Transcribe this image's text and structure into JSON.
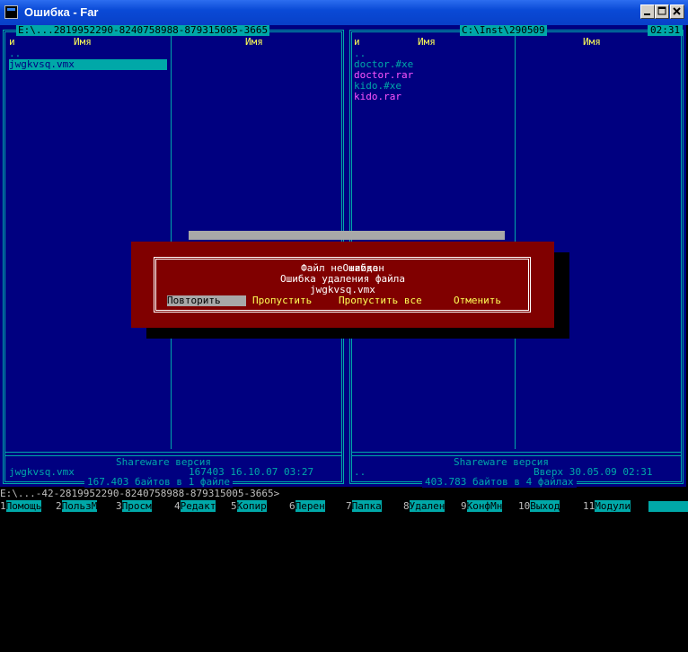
{
  "window": {
    "title": "Ошибка - Far"
  },
  "left_panel": {
    "path": "E:\\...2819952290-8240758988-879315005-3665",
    "col_headers": [
      "и",
      "Имя",
      "Имя"
    ],
    "items": [
      "..",
      "jwgkvsq.vmx"
    ],
    "shareware": "Shareware версия",
    "status_name": "jwgkvsq.vmx",
    "status_info": "167403 16.10.07 03:27",
    "summary": "167.403 байтов в 1 файле"
  },
  "right_panel": {
    "path": "C:\\Inst\\290509",
    "clock": "02:31",
    "col_headers": [
      "и",
      "Имя",
      "Имя"
    ],
    "items": [
      "..",
      "doctor.#xe",
      "doctor.rar",
      "kido.#xe",
      "kido.rar"
    ],
    "shareware": "Shareware версия",
    "status_name": "..",
    "status_info": "Вверх 30.05.09 02:31",
    "summary": "403.783 байтов в 4 файлах"
  },
  "dialog": {
    "title": "Ошибка",
    "line1": "Файл не найден",
    "line2": "Ошибка удаления файла",
    "line3": "jwgkvsq.vmx",
    "buttons": [
      "Повторить",
      "Пропустить",
      "Пропустить все",
      "Отменить"
    ]
  },
  "command_line": "E:\\...-42-2819952290-8240758988-879315005-3665>",
  "keybar": [
    {
      "num": "1",
      "label": "Помощь"
    },
    {
      "num": "2",
      "label": "ПользМ"
    },
    {
      "num": "3",
      "label": "Просм"
    },
    {
      "num": "4",
      "label": "Редакт"
    },
    {
      "num": "5",
      "label": "Копир"
    },
    {
      "num": "6",
      "label": "Перен"
    },
    {
      "num": "7",
      "label": "Папка"
    },
    {
      "num": "8",
      "label": "Удален"
    },
    {
      "num": "9",
      "label": "КонфМн"
    },
    {
      "num": "10",
      "label": "Выход"
    },
    {
      "num": "11",
      "label": "Модули"
    }
  ],
  "colors": {
    "panel_bg": "#000080",
    "frame": "#00a8a8",
    "header_text": "#ffff55",
    "archive_text": "#ff55ff",
    "dialog_bg": "#800000"
  }
}
